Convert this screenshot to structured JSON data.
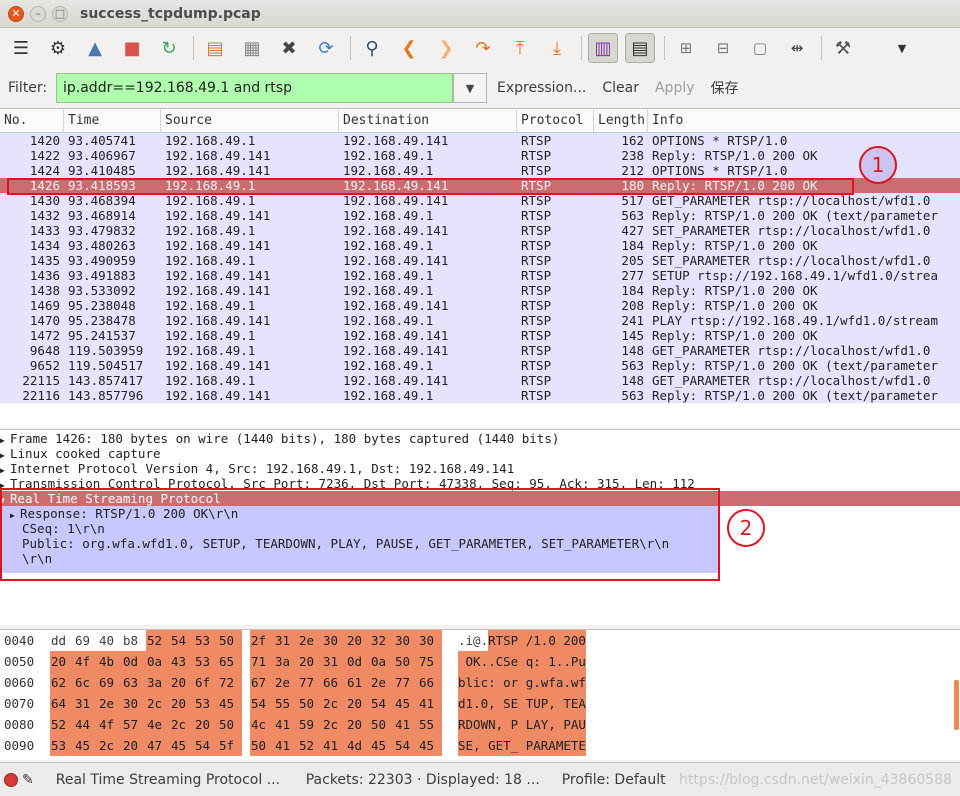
{
  "window": {
    "title": "success_tcpdump.pcap"
  },
  "toolbar": {
    "buttons": [
      "interfaces-icon",
      "options-icon",
      "start-icon",
      "stop-icon",
      "restart-icon",
      "open-icon",
      "save-icon",
      "close-icon",
      "reload-icon",
      "find-icon",
      "back-icon",
      "forward-icon",
      "goto-icon",
      "first-icon",
      "last-icon",
      "colorize-icon",
      "autoscroll-icon",
      "zoom-in-icon",
      "zoom-out-icon",
      "normal-size-icon",
      "resize-columns-icon",
      "preferences-icon"
    ]
  },
  "filter": {
    "label": "Filter:",
    "value": "ip.addr==192.168.49.1 and rtsp",
    "expression": "Expression...",
    "clear": "Clear",
    "apply": "Apply",
    "save": "保存"
  },
  "packet_list": {
    "columns": [
      "No.",
      "Time",
      "Source",
      "Destination",
      "Protocol",
      "Length",
      "Info"
    ],
    "rows": [
      {
        "no": "1420",
        "time": "93.405741",
        "src": "192.168.49.1",
        "dst": "192.168.49.141",
        "proto": "RTSP",
        "len": "162",
        "info": "OPTIONS * RTSP/1.0"
      },
      {
        "no": "1422",
        "time": "93.406967",
        "src": "192.168.49.141",
        "dst": "192.168.49.1",
        "proto": "RTSP",
        "len": "238",
        "info": "Reply: RTSP/1.0 200 OK"
      },
      {
        "no": "1424",
        "time": "93.410485",
        "src": "192.168.49.141",
        "dst": "192.168.49.1",
        "proto": "RTSP",
        "len": "212",
        "info": "OPTIONS * RTSP/1.0"
      },
      {
        "no": "1426",
        "time": "93.418593",
        "src": "192.168.49.1",
        "dst": "192.168.49.141",
        "proto": "RTSP",
        "len": "180",
        "info": "Reply: RTSP/1.0 200 OK"
      },
      {
        "no": "1430",
        "time": "93.468394",
        "src": "192.168.49.1",
        "dst": "192.168.49.141",
        "proto": "RTSP",
        "len": "517",
        "info": "GET_PARAMETER rtsp://localhost/wfd1.0"
      },
      {
        "no": "1432",
        "time": "93.468914",
        "src": "192.168.49.141",
        "dst": "192.168.49.1",
        "proto": "RTSP",
        "len": "563",
        "info": "Reply: RTSP/1.0 200 OK (text/parameter"
      },
      {
        "no": "1433",
        "time": "93.479832",
        "src": "192.168.49.1",
        "dst": "192.168.49.141",
        "proto": "RTSP",
        "len": "427",
        "info": "SET_PARAMETER rtsp://localhost/wfd1.0"
      },
      {
        "no": "1434",
        "time": "93.480263",
        "src": "192.168.49.141",
        "dst": "192.168.49.1",
        "proto": "RTSP",
        "len": "184",
        "info": "Reply: RTSP/1.0 200 OK"
      },
      {
        "no": "1435",
        "time": "93.490959",
        "src": "192.168.49.1",
        "dst": "192.168.49.141",
        "proto": "RTSP",
        "len": "205",
        "info": "SET_PARAMETER rtsp://localhost/wfd1.0"
      },
      {
        "no": "1436",
        "time": "93.491883",
        "src": "192.168.49.141",
        "dst": "192.168.49.1",
        "proto": "RTSP",
        "len": "277",
        "info": "SETUP rtsp://192.168.49.1/wfd1.0/strea"
      },
      {
        "no": "1438",
        "time": "93.533092",
        "src": "192.168.49.141",
        "dst": "192.168.49.1",
        "proto": "RTSP",
        "len": "184",
        "info": "Reply: RTSP/1.0 200 OK"
      },
      {
        "no": "1469",
        "time": "95.238048",
        "src": "192.168.49.1",
        "dst": "192.168.49.141",
        "proto": "RTSP",
        "len": "208",
        "info": "Reply: RTSP/1.0 200 OK"
      },
      {
        "no": "1470",
        "time": "95.238478",
        "src": "192.168.49.141",
        "dst": "192.168.49.1",
        "proto": "RTSP",
        "len": "241",
        "info": "PLAY rtsp://192.168.49.1/wfd1.0/stream"
      },
      {
        "no": "1472",
        "time": "95.241537",
        "src": "192.168.49.1",
        "dst": "192.168.49.141",
        "proto": "RTSP",
        "len": "145",
        "info": "Reply: RTSP/1.0 200 OK"
      },
      {
        "no": "9648",
        "time": "119.503959",
        "src": "192.168.49.1",
        "dst": "192.168.49.141",
        "proto": "RTSP",
        "len": "148",
        "info": "GET_PARAMETER rtsp://localhost/wfd1.0"
      },
      {
        "no": "9652",
        "time": "119.504517",
        "src": "192.168.49.141",
        "dst": "192.168.49.1",
        "proto": "RTSP",
        "len": "563",
        "info": "Reply: RTSP/1.0 200 OK (text/parameter"
      },
      {
        "no": "22115",
        "time": "143.857417",
        "src": "192.168.49.1",
        "dst": "192.168.49.141",
        "proto": "RTSP",
        "len": "148",
        "info": "GET_PARAMETER rtsp://localhost/wfd1.0"
      },
      {
        "no": "22116",
        "time": "143.857796",
        "src": "192.168.49.141",
        "dst": "192.168.49.1",
        "proto": "RTSP",
        "len": "563",
        "info": "Reply: RTSP/1.0 200 OK (text/parameter"
      }
    ]
  },
  "details": {
    "frame": "Frame 1426: 180 bytes on wire (1440 bits), 180 bytes captured (1440 bits)",
    "linux": "Linux cooked capture",
    "ip": "Internet Protocol Version 4, Src: 192.168.49.1, Dst: 192.168.49.141",
    "tcp": "Transmission Control Protocol, Src Port: 7236, Dst Port: 47338, Seq: 95, Ack: 315, Len: 112",
    "rtsp": "Real Time Streaming Protocol",
    "response": "Response: RTSP/1.0 200 OK\\r\\n",
    "cseq": "CSeq: 1\\r\\n",
    "public": "Public: org.wfa.wfd1.0, SETUP, TEARDOWN, PLAY, PAUSE, GET_PARAMETER, SET_PARAMETER\\r\\n",
    "crlf": "\\r\\n"
  },
  "bytes": {
    "rows": [
      {
        "off": "0040",
        "hex": [
          "dd",
          "69",
          "40",
          "b8",
          "52",
          "54",
          "53",
          "50",
          "2f",
          "31",
          "2e",
          "30",
          "20",
          "32",
          "30",
          "30"
        ],
        "hl_from": 4,
        "ascii_plain": ".i@.",
        "ascii_hl": "RTSP /1.0 200"
      },
      {
        "off": "0050",
        "hex": [
          "20",
          "4f",
          "4b",
          "0d",
          "0a",
          "43",
          "53",
          "65",
          "71",
          "3a",
          "20",
          "31",
          "0d",
          "0a",
          "50",
          "75"
        ],
        "hl_from": 0,
        "ascii_plain": "",
        "ascii_hl": " OK..CSe q: 1..Pu"
      },
      {
        "off": "0060",
        "hex": [
          "62",
          "6c",
          "69",
          "63",
          "3a",
          "20",
          "6f",
          "72",
          "67",
          "2e",
          "77",
          "66",
          "61",
          "2e",
          "77",
          "66"
        ],
        "hl_from": 0,
        "ascii_plain": "",
        "ascii_hl": "blic: or g.wfa.wf"
      },
      {
        "off": "0070",
        "hex": [
          "64",
          "31",
          "2e",
          "30",
          "2c",
          "20",
          "53",
          "45",
          "54",
          "55",
          "50",
          "2c",
          "20",
          "54",
          "45",
          "41"
        ],
        "hl_from": 0,
        "ascii_plain": "",
        "ascii_hl": "d1.0, SE TUP, TEA"
      },
      {
        "off": "0080",
        "hex": [
          "52",
          "44",
          "4f",
          "57",
          "4e",
          "2c",
          "20",
          "50",
          "4c",
          "41",
          "59",
          "2c",
          "20",
          "50",
          "41",
          "55"
        ],
        "hl_from": 0,
        "ascii_plain": "",
        "ascii_hl": "RDOWN, P LAY, PAU"
      },
      {
        "off": "0090",
        "hex": [
          "53",
          "45",
          "2c",
          "20",
          "47",
          "45",
          "54",
          "5f",
          "50",
          "41",
          "52",
          "41",
          "4d",
          "45",
          "54",
          "45"
        ],
        "hl_from": 0,
        "ascii_plain": "",
        "ascii_hl": "SE, GET_ PARAMETE"
      }
    ]
  },
  "status": {
    "field": "Real Time Streaming Protocol ...",
    "packets": "Packets: 22303 · Displayed: 18 ...",
    "profile": "Profile: Default",
    "watermark": "https://blog.csdn.net/weixin_43860588"
  },
  "annotations": {
    "one": "1",
    "two": "2"
  },
  "colors": {
    "rtsp_row": "#e4e4ff",
    "selected_row": "#cc6b70",
    "highlight": "#f08a65",
    "annotation": "#e0141e",
    "filter_ok": "#afffaf"
  }
}
